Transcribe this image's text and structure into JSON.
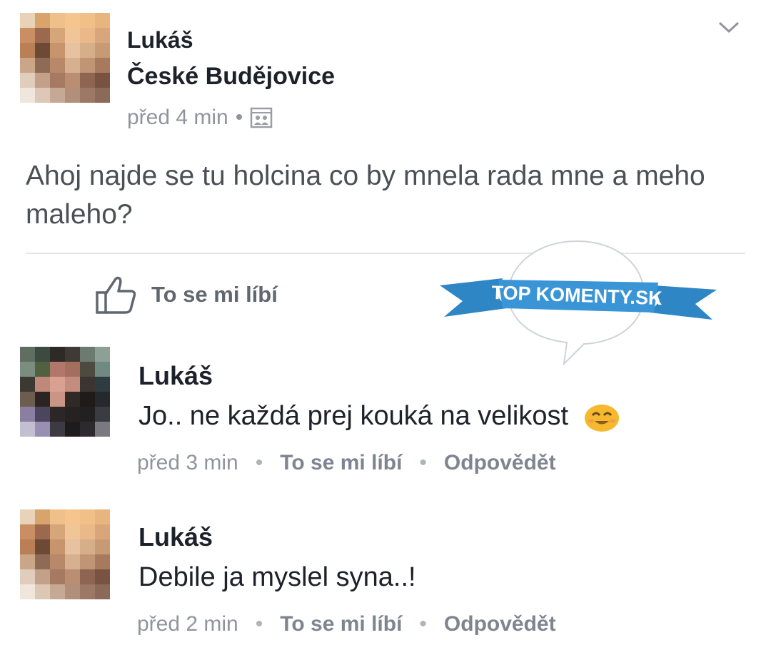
{
  "post": {
    "author": "Lukáš",
    "location": "České Budějovice",
    "time": "před 4 min",
    "dot": "•",
    "audience_icon": "group-icon",
    "text": "Ahoj najde se tu holcina co by mnela rada mne a meho maleho?",
    "like_label": "To se mi líbí"
  },
  "watermark": {
    "text": "TOP KOMENTY.SK",
    "color": "#2f86c5"
  },
  "comments": [
    {
      "author": "Lukáš",
      "text": "Jo.. ne každá prej kouká na velikost",
      "time": "před 3 min",
      "like": "To se mi líbí",
      "reply": "Odpovědět",
      "emoji": "smiling-face-icon"
    },
    {
      "author": "Lukáš",
      "text": "Debile ja myslel syna..!",
      "time": "před 2 min",
      "like": "To se mi líbí",
      "reply": "Odpovědět"
    }
  ],
  "separator": "•"
}
